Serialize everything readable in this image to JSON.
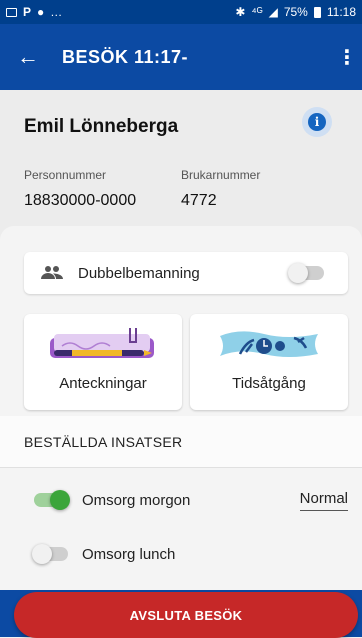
{
  "status_bar": {
    "signal": "⁴ᴳ",
    "battery": "75%",
    "time": "11:18"
  },
  "app_bar": {
    "title": "BESÖK 11:17-",
    "back_icon": "arrow-back-icon",
    "menu_icon": "more-vert-icon"
  },
  "person": {
    "name": "Emil Lönneberga",
    "info_icon": "info-icon",
    "personnummer_label": "Personnummer",
    "personnummer": "18830000-0000",
    "brukarnummer_label": "Brukarnummer",
    "brukarnummer": "4772"
  },
  "dubbel": {
    "label": "Dubbelbemanning",
    "enabled": false,
    "icon": "people-icon"
  },
  "tiles": {
    "notes_label": "Anteckningar",
    "time_label": "Tidsåtgång"
  },
  "section": {
    "title": "BESTÄLLDA INSATSER"
  },
  "insatser": [
    {
      "label": "Omsorg morgon",
      "enabled": true,
      "level": "Normal"
    },
    {
      "label": "Omsorg lunch",
      "enabled": false,
      "level": ""
    }
  ],
  "end_button": {
    "label": "AVSLUTA BESÖK"
  },
  "colors": {
    "primary": "#0c4aa3",
    "status_bar": "#003f8c",
    "danger": "#c62828",
    "switch_on": "#3ba53a",
    "info": "#1565c0"
  }
}
